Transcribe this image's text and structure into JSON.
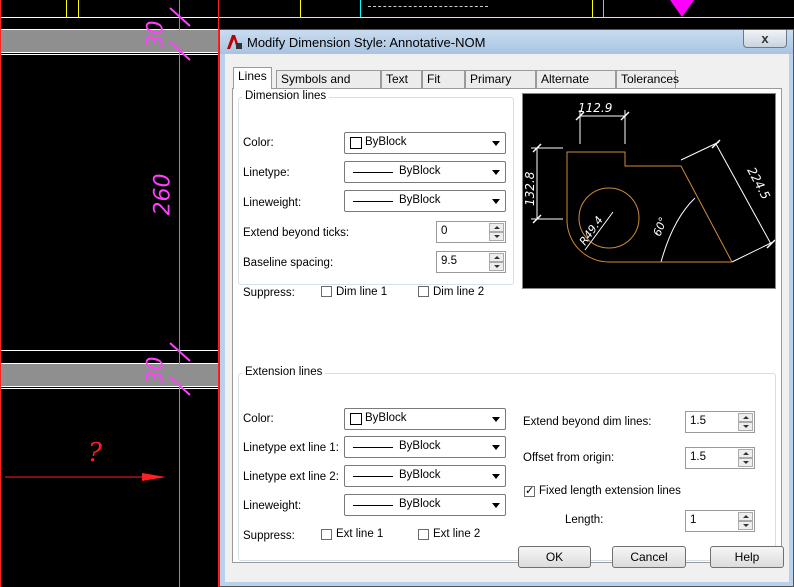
{
  "cad": {
    "dim_top": "30",
    "dim_mid": "260",
    "dim_bottom": "30",
    "question_mark": "?"
  },
  "dialog": {
    "title": "Modify Dimension Style: Annotative-NOM",
    "close_glyph": "x",
    "tabs": [
      "Lines",
      "Symbols and Arrows",
      "Text",
      "Fit",
      "Primary Units",
      "Alternate Units",
      "Tolerances"
    ],
    "active_tab": "Lines",
    "dimension_lines": {
      "title": "Dimension lines",
      "color_label": "Color:",
      "color_value": "ByBlock",
      "linetype_label": "Linetype:",
      "linetype_value": "ByBlock",
      "lineweight_label": "Lineweight:",
      "lineweight_value": "ByBlock",
      "extend_label": "Extend beyond ticks:",
      "extend_value": "0",
      "baseline_label": "Baseline spacing:",
      "baseline_value": "9.5",
      "suppress_label": "Suppress:",
      "dim_line_1": "Dim line 1",
      "dim_line_2": "Dim line 2"
    },
    "preview": {
      "d1": "112.9",
      "d2": "132.8",
      "d3": "224.5",
      "d4": "R49.4",
      "d5": "60°"
    },
    "extension_lines": {
      "title": "Extension lines",
      "color_label": "Color:",
      "color_value": "ByBlock",
      "lt1_label": "Linetype ext line 1:",
      "lt1_value": "ByBlock",
      "lt2_label": "Linetype ext line 2:",
      "lt2_value": "ByBlock",
      "lineweight_label": "Lineweight:",
      "lineweight_value": "ByBlock",
      "suppress_label": "Suppress:",
      "ext_line_1": "Ext line 1",
      "ext_line_2": "Ext line 2",
      "extend_label": "Extend beyond dim lines:",
      "extend_value": "1.5",
      "offset_label": "Offset from origin:",
      "offset_value": "1.5",
      "fixed_label": "Fixed length extension lines",
      "fixed_checked": true,
      "length_label": "Length:",
      "length_value": "1"
    },
    "buttons": {
      "ok": "OK",
      "cancel": "Cancel",
      "help": "Help"
    }
  }
}
